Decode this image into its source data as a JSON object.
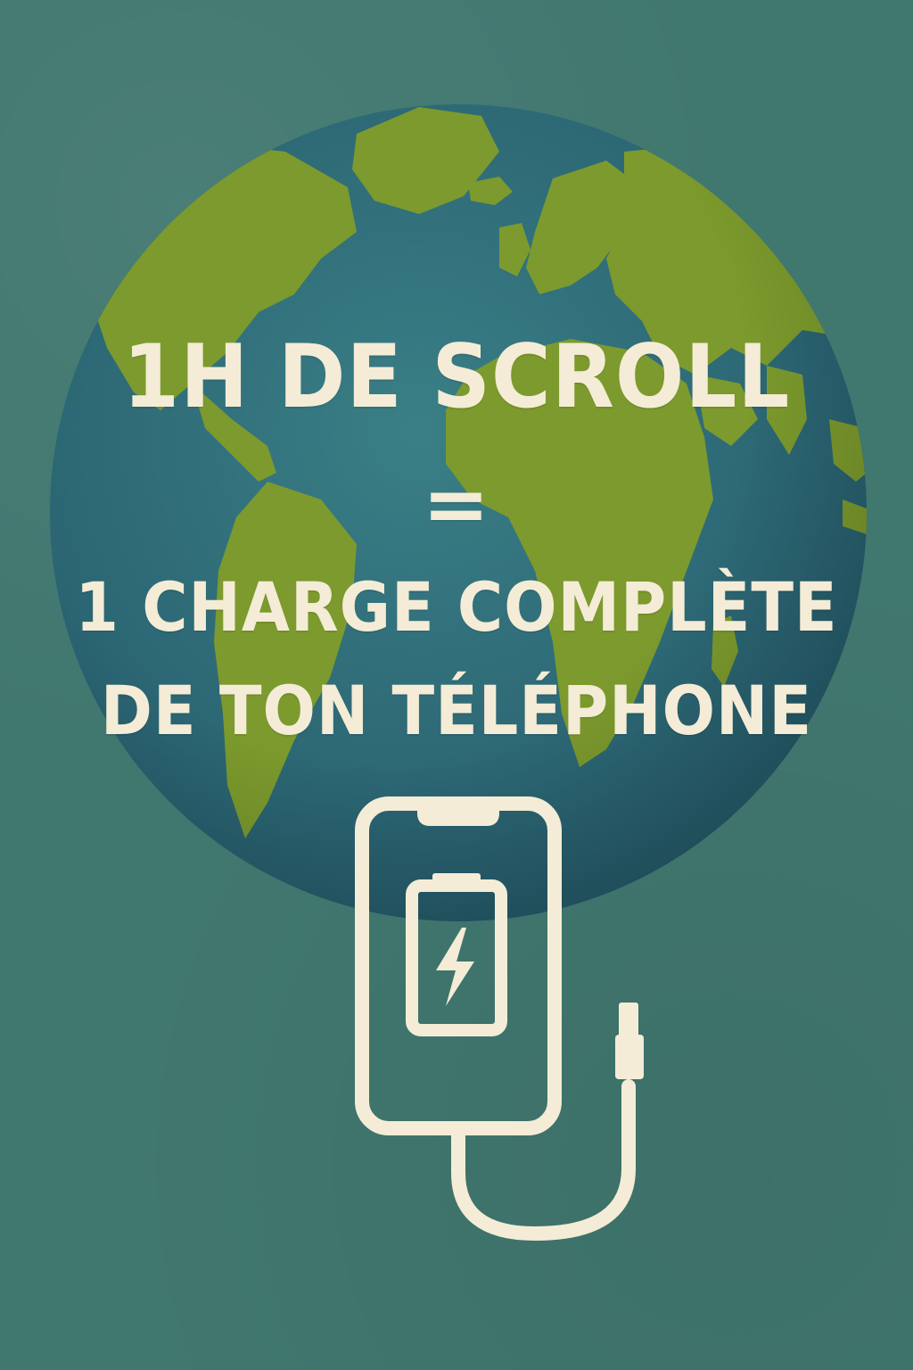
{
  "poster": {
    "headline_line_1": "1H DE SCROLL",
    "equals_sign": "=",
    "headline_line_3": "1 CHARGE COMPLÈTE",
    "headline_line_4": "DE TON TÉLÉPHONE"
  },
  "colors": {
    "background": "#40776f",
    "ocean": "#2e6a72",
    "land": "#7c9a2d",
    "text_and_icon": "#f4ecd6"
  },
  "icons": [
    "globe-icon",
    "smartphone-icon",
    "battery-charging-icon",
    "usb-cable-icon"
  ]
}
